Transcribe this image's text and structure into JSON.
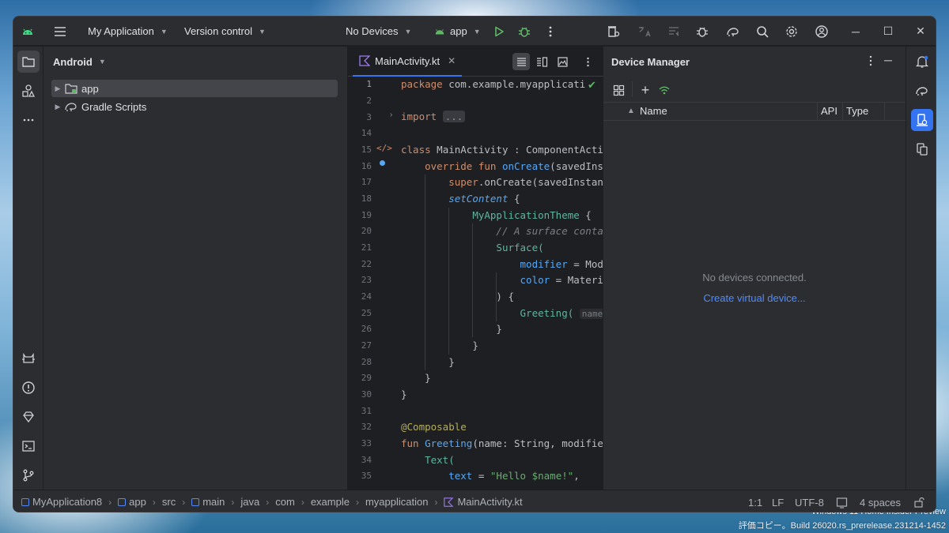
{
  "desktop": {
    "watermark_line1": "Windows 11 Home Insider Preview",
    "watermark_line2": "評価コピー。Build 26020.rs_prerelease.231214-1452"
  },
  "titlebar": {
    "project": "My Application",
    "vcs": "Version control",
    "devices": "No Devices",
    "run_config": "app"
  },
  "project_panel": {
    "view": "Android",
    "tree": [
      {
        "label": "app",
        "icon": "module-folder-icon",
        "selected": true
      },
      {
        "label": "Gradle Scripts",
        "icon": "gradle-elephant-icon",
        "selected": false
      }
    ]
  },
  "editor": {
    "tab_label": "MainActivity.kt",
    "line_numbers": [
      "1",
      "2",
      "3",
      "14",
      "15",
      "16",
      "17",
      "18",
      "19",
      "20",
      "21",
      "22",
      "23",
      "24",
      "25",
      "26",
      "27",
      "28",
      "29",
      "30",
      "31",
      "32",
      "33",
      "34",
      "35"
    ],
    "code": {
      "l1a": "package",
      "l1b": " com.example.myapplicati",
      "l3a": "import",
      "l3b": "...",
      "l15a": "class",
      "l15b": " MainActivity : ComponentActi",
      "l16a": "    override fun",
      "l16b": "onCreate",
      "l16c": "(savedIns",
      "l17a": "        super",
      "l17b": ".onCreate(savedInstan",
      "l18a": "setContent",
      "l18b": " {",
      "l19a": "MyApplicationTheme",
      "l19b": " {",
      "l20": "// A surface conta",
      "l21": "Surface(",
      "l22a": "modifier",
      "l22b": " = Mod",
      "l23a": "color",
      "l23b": " = Materi",
      "l24": ") {",
      "l25a": "Greeting(",
      "l25b": "name",
      "l26": "}",
      "l27": "}",
      "l28": "}",
      "l29": "}",
      "l30": "}",
      "l32": "@Composable",
      "l33a": "fun",
      "l33b": "Greeting",
      "l33c": "(name: String, modifie",
      "l34": "Text(",
      "l35a": "text",
      "l35b": " = ",
      "l35c": "\"Hello $name!\"",
      "l35d": ","
    }
  },
  "device_manager": {
    "title": "Device Manager",
    "col_name": "Name",
    "col_api": "API",
    "col_type": "Type",
    "empty_text": "No devices connected.",
    "create_link": "Create virtual device..."
  },
  "statusbar": {
    "breadcrumbs": [
      "MyApplication8",
      "app",
      "src",
      "main",
      "java",
      "com",
      "example",
      "myapplication",
      "MainActivity.kt"
    ],
    "position": "1:1",
    "line_sep": "LF",
    "encoding": "UTF-8",
    "indent": "4 spaces"
  },
  "colors": {
    "accent": "#3574f0",
    "link": "#548af7",
    "run_green": "#5fb865",
    "android_green": "#3ddc84"
  }
}
